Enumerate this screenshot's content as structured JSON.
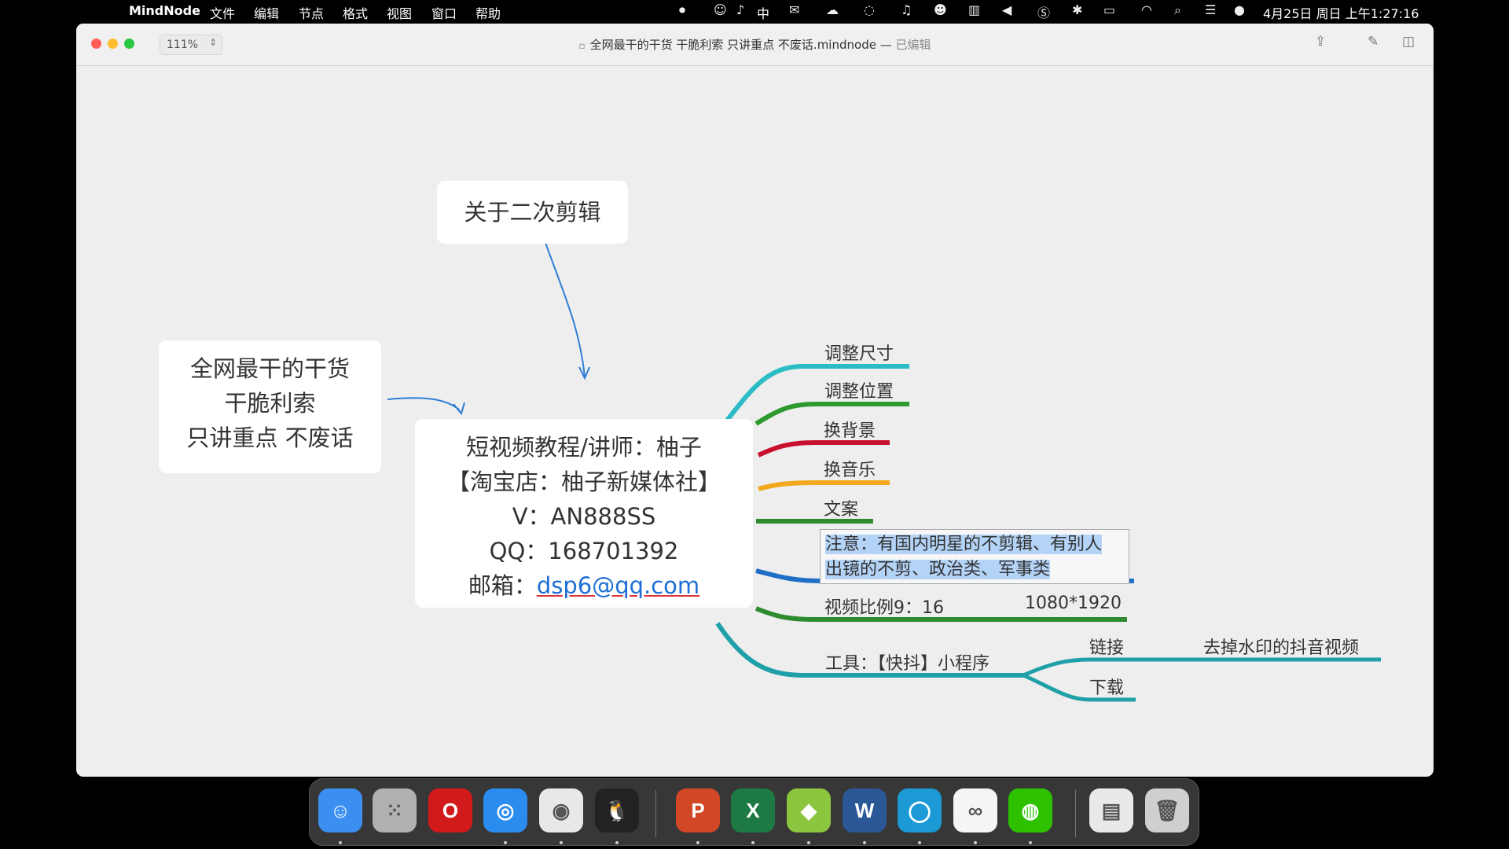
{
  "menubar": {
    "app_name": "MindNode",
    "items": [
      "文件",
      "编辑",
      "节点",
      "格式",
      "视图",
      "窗口",
      "帮助"
    ],
    "input_method": "中",
    "datetime": "4月25日 周日 上午1:27:16"
  },
  "window": {
    "zoom": "111%",
    "title": "全网最干的干货 干脆利索 只讲重点 不废话.mindnode",
    "title_sep": " — ",
    "status": "已编辑"
  },
  "mindmap": {
    "top_node": "关于二次剪辑",
    "left_node": {
      "lines": [
        "全网最干的干货",
        "干脆利索",
        "只讲重点 不废话"
      ]
    },
    "center_node": {
      "line1": "短视频教程/讲师：柚子",
      "line2": "【淘宝店：柚子新媒体社】",
      "line3": "V：AN888SS",
      "line4": "QQ：168701392",
      "email_label": "邮箱：",
      "email": "dsp6@qq.com"
    },
    "branches": [
      {
        "label": "调整尺寸",
        "color": "#2bbcc6"
      },
      {
        "label": "调整位置",
        "color": "#2e9a2e"
      },
      {
        "label": "换背景",
        "color": "#c8102e"
      },
      {
        "label": "换音乐",
        "color": "#f2a81d"
      },
      {
        "label": "文案",
        "color": "#2e8b2e"
      },
      {
        "label": "视频比例9：16",
        "extra": "1080*1920",
        "color": "#2e8b2e"
      },
      {
        "label": "工具：【快抖】小程序",
        "color": "#1fa0a8"
      }
    ],
    "note": {
      "line1": "注意：有国内明星的不剪辑、有别人",
      "line2": "出镜的不剪、政治类、军事类",
      "color": "#1f6fc6"
    },
    "tool_children": {
      "link": "链接",
      "link_child": "去掉水印的抖音视频",
      "download": "下载"
    }
  },
  "dock": {
    "apps": [
      {
        "name": "finder-icon",
        "color": "#3c8ff0",
        "glyph": "☺"
      },
      {
        "name": "launchpad-icon",
        "color": "#b0b0b0",
        "glyph": "⁙"
      },
      {
        "name": "opera-icon",
        "color": "#d21a1a",
        "glyph": "O"
      },
      {
        "name": "safari-icon",
        "color": "#2b8cf0",
        "glyph": "◎"
      },
      {
        "name": "chrome-icon",
        "color": "#e8e8e8",
        "glyph": "◉"
      },
      {
        "name": "qq-icon",
        "color": "#222",
        "glyph": "🐧"
      },
      {
        "name": "powerpoint-icon",
        "color": "#d24726",
        "glyph": "P"
      },
      {
        "name": "excel-icon",
        "color": "#1d7a45",
        "glyph": "X"
      },
      {
        "name": "mindnode-icon",
        "color": "#8cc63f",
        "glyph": "◆"
      },
      {
        "name": "word-icon",
        "color": "#2b5797",
        "glyph": "W"
      },
      {
        "name": "chat-bubble-icon",
        "color": "#1b9ad6",
        "glyph": "◯"
      },
      {
        "name": "baidu-netdisk-icon",
        "color": "#f5f5f5",
        "glyph": "∞"
      },
      {
        "name": "wechat-icon",
        "color": "#2dc100",
        "glyph": "◍"
      },
      {
        "name": "docx-file-icon",
        "color": "#e9e9e9",
        "glyph": "▤"
      },
      {
        "name": "trash-icon",
        "color": "#cfcfcf",
        "glyph": "🗑"
      }
    ]
  }
}
